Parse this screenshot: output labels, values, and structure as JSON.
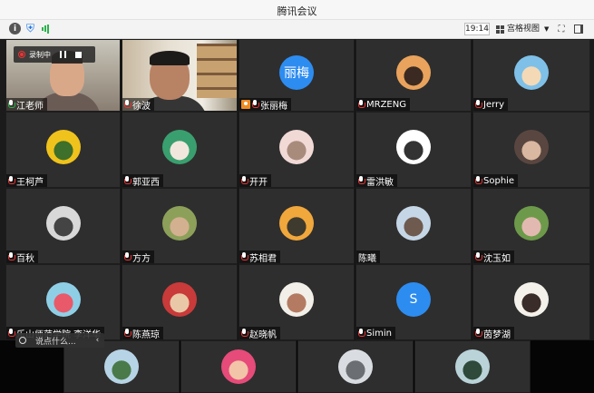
{
  "window": {
    "title": "腾讯会议"
  },
  "toolbar": {
    "time": "19:14",
    "view_label": "宫格视图"
  },
  "recording": {
    "label": "录制中"
  },
  "participants": [
    {
      "name": "江老师",
      "type": "video",
      "mic": "on"
    },
    {
      "name": "徐波",
      "type": "video",
      "mic": "off"
    },
    {
      "name": "张丽梅",
      "type": "text",
      "initials": "丽梅",
      "host": true,
      "mic": "off"
    },
    {
      "name": "MRZENG",
      "type": "photo",
      "colors": [
        "#e9a35c",
        "#3b2a22"
      ],
      "mic": "off"
    },
    {
      "name": "Jerry",
      "type": "photo",
      "colors": [
        "#7ec0e8",
        "#f4d9b6"
      ],
      "mic": "off"
    },
    {
      "name": "王柯芦",
      "type": "photo",
      "colors": [
        "#f0c21c",
        "#3e6f2b"
      ],
      "mic": "off"
    },
    {
      "name": "郭亚西",
      "type": "photo",
      "colors": [
        "#3a9f6e",
        "#f2e7dc"
      ],
      "mic": "off"
    },
    {
      "name": "开开",
      "type": "photo",
      "colors": [
        "#f1d9d6",
        "#a98b7c"
      ],
      "mic": "off"
    },
    {
      "name": "雷洪敏",
      "type": "photo",
      "colors": [
        "#ffffff",
        "#333333"
      ],
      "mic": "off"
    },
    {
      "name": "Sophie",
      "type": "photo",
      "colors": [
        "#5a4640",
        "#d9b7a0"
      ],
      "mic": "off"
    },
    {
      "name": "百秋",
      "type": "photo",
      "colors": [
        "#d8d8d8",
        "#444444"
      ],
      "mic": "off"
    },
    {
      "name": "方方",
      "type": "photo",
      "colors": [
        "#8da05a",
        "#d3b090"
      ],
      "mic": "off"
    },
    {
      "name": "苏相君",
      "type": "photo",
      "colors": [
        "#f0a73c",
        "#3f3a2e"
      ],
      "mic": "off"
    },
    {
      "name": "陈曦",
      "type": "photo",
      "colors": [
        "#c5d6e6",
        "#6e5a4f"
      ],
      "mic": "none"
    },
    {
      "name": "沈玉如",
      "type": "photo",
      "colors": [
        "#6d9a4a",
        "#e2b9b0"
      ],
      "mic": "off"
    },
    {
      "name": "乐山师范学院  李洋华",
      "type": "photo",
      "colors": [
        "#8fcfe6",
        "#e85a6a"
      ],
      "mic": "off"
    },
    {
      "name": "陈燕琼",
      "type": "photo",
      "colors": [
        "#c93a3a",
        "#e9c8a7"
      ],
      "mic": "off"
    },
    {
      "name": "赵晓帆",
      "type": "photo",
      "colors": [
        "#f2efe8",
        "#b47b62"
      ],
      "mic": "off"
    },
    {
      "name": "Simin",
      "type": "text",
      "initials": "S",
      "mic": "off"
    },
    {
      "name": "茵梦湖",
      "type": "photo",
      "colors": [
        "#f4f1ea",
        "#3a2c28"
      ],
      "mic": "off"
    }
  ],
  "bottom_row": [
    {
      "colors": [
        "#b7d4e6",
        "#4a7a4a"
      ]
    },
    {
      "colors": [
        "#e64b7a",
        "#f2c4a8"
      ]
    },
    {
      "colors": [
        "#d9dde2",
        "#6b6e72"
      ]
    },
    {
      "colors": [
        "#b9d3d8",
        "#2f4a3a"
      ]
    }
  ],
  "chat": {
    "placeholder": "说点什么..."
  }
}
